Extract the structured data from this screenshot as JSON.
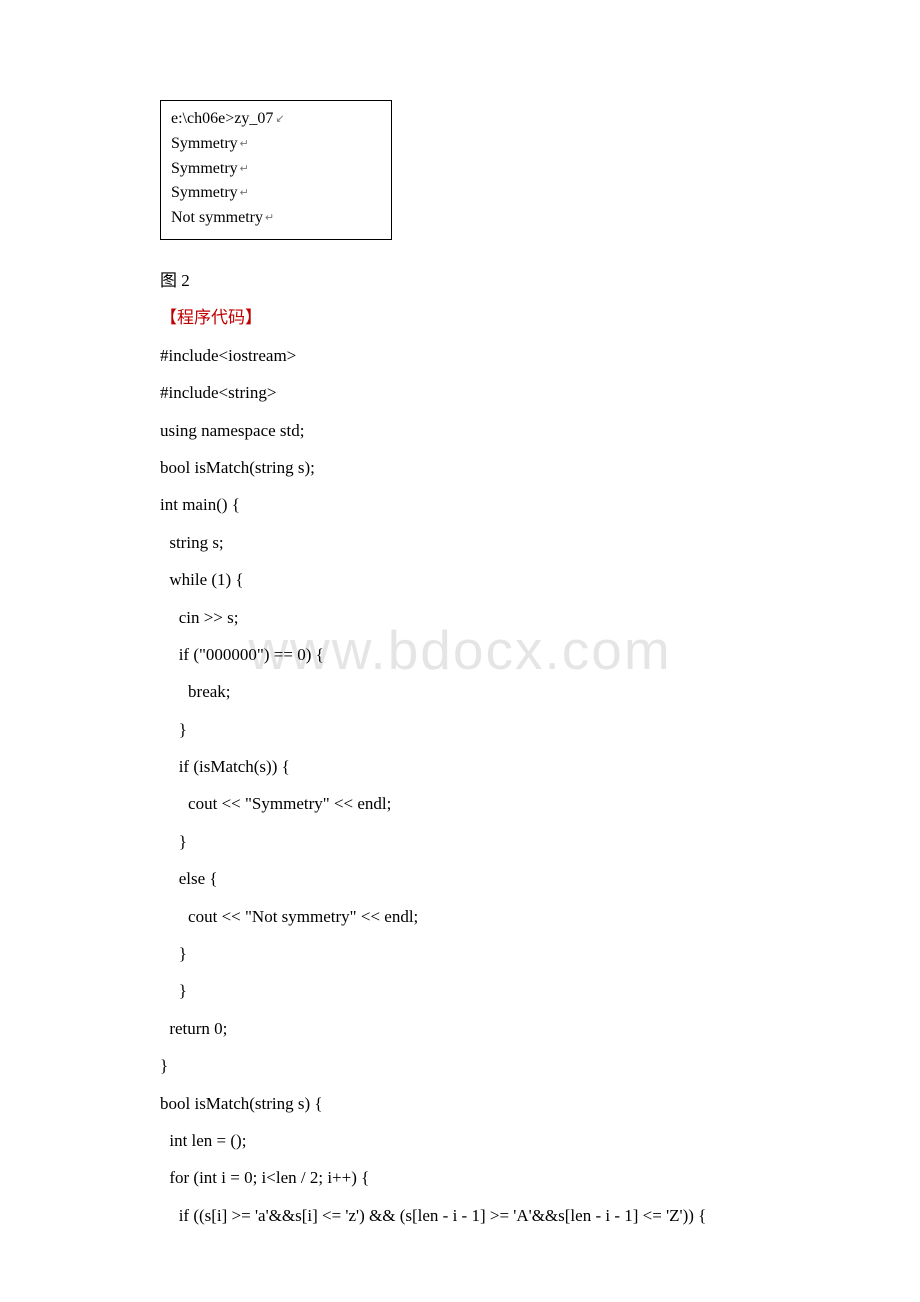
{
  "watermark": "www.bdocx.com",
  "output_box": {
    "lines": [
      "e:\\ch06e>zy_07",
      "Symmetry",
      "Symmetry",
      "Symmetry",
      "Not symmetry"
    ]
  },
  "caption": "图 2",
  "heading": "【程序代码】",
  "code": [
    {
      "indent": 0,
      "text": "#include<iostream>"
    },
    {
      "indent": 0,
      "text": "#include<string>"
    },
    {
      "indent": 0,
      "text": "using namespace std;"
    },
    {
      "indent": 0,
      "text": "bool isMatch(string s);"
    },
    {
      "indent": 0,
      "text": "int main() {"
    },
    {
      "indent": 1,
      "text": "string s;"
    },
    {
      "indent": 1,
      "text": "while (1) {"
    },
    {
      "indent": 2,
      "text": "cin >> s;"
    },
    {
      "indent": 2,
      "text": "if (\"000000\") == 0) {"
    },
    {
      "indent": 3,
      "text": "break;"
    },
    {
      "indent": 2,
      "text": "}"
    },
    {
      "indent": 2,
      "text": "if (isMatch(s)) {"
    },
    {
      "indent": 3,
      "text": "cout << \"Symmetry\" << endl;"
    },
    {
      "indent": 2,
      "text": "}"
    },
    {
      "indent": 2,
      "text": "else {"
    },
    {
      "indent": 3,
      "text": "cout << \"Not symmetry\" << endl;"
    },
    {
      "indent": 2,
      "text": "}"
    },
    {
      "indent": 2,
      "text": "}"
    },
    {
      "indent": 1,
      "text": "return 0;"
    },
    {
      "indent": 0,
      "text": "}"
    },
    {
      "indent": 0,
      "text": "bool isMatch(string s) {"
    },
    {
      "indent": 1,
      "text": "int len = ();"
    },
    {
      "indent": 1,
      "text": "for (int i = 0; i<len / 2; i++) {"
    },
    {
      "indent": 2,
      "text": "if ((s[i] >= 'a'&&s[i] <= 'z') && (s[len - i - 1] >= 'A'&&s[len - i - 1] <= 'Z')) {"
    }
  ]
}
